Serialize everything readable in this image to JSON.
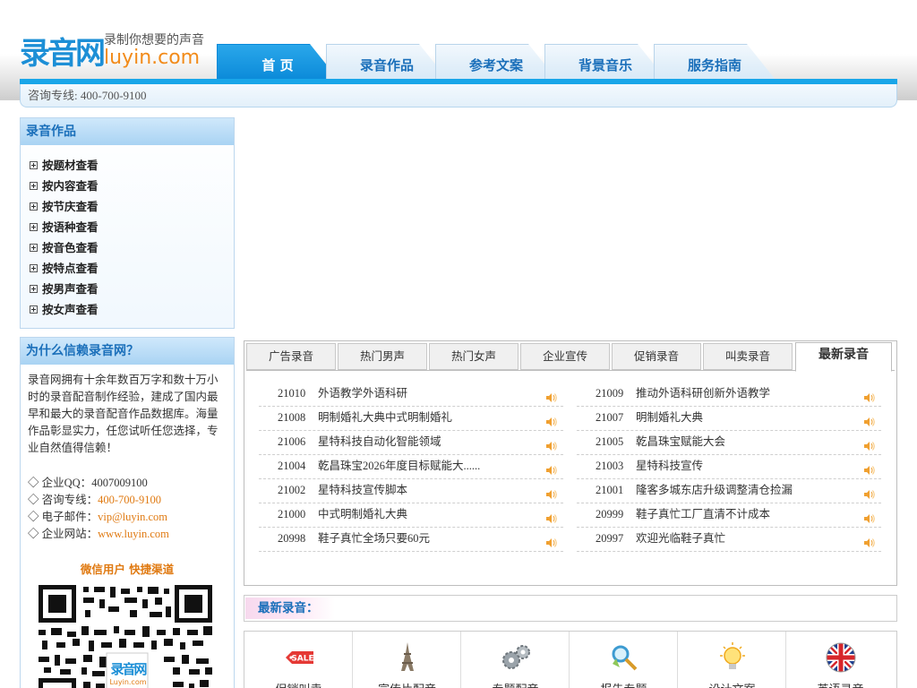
{
  "site": {
    "logo_mark": "录音网",
    "slogan": "录制你想要的声音",
    "domain": "luyin.com"
  },
  "nav": [
    {
      "label": "首 页",
      "active": true
    },
    {
      "label": "录音作品"
    },
    {
      "label": "参考文案"
    },
    {
      "label": "背景音乐"
    },
    {
      "label": "服务指南"
    }
  ],
  "hotline": "咨询专线: 400-700-9100",
  "works_panel": {
    "title": "录音作品",
    "items": [
      "按题材查看",
      "按内容查看",
      "按节庆查看",
      "按语种查看",
      "按音色查看",
      "按特点查看",
      "按男声查看",
      "按女声查看"
    ]
  },
  "why_panel": {
    "title": "为什么信赖录音网？",
    "intro": "录音网拥有十余年数百万字和数十万小时的录音配音制作经验，建成了国内最早和最大的录音配音作品数据库。海量作品彰显实力，任您试听任您选择，专业自然值得信赖！",
    "contacts": [
      {
        "label": "◇ 企业QQ：",
        "value": "4007009100",
        "accent": false
      },
      {
        "label": "◇ 咨询专线：",
        "value": "400-700-9100",
        "accent": true
      },
      {
        "label": "◇ 电子邮件：",
        "value": "vip@luyin.com",
        "accent": true
      },
      {
        "label": "◇ 企业网站：",
        "value": "www.luyin.com",
        "accent": true
      }
    ],
    "wechat": "微信用户 快捷渠道",
    "qr_logo": "录音网",
    "qr_domain": "Luyin.com"
  },
  "tabs": [
    "广告录音",
    "热门男声",
    "热门女声",
    "企业宣传",
    "促销录音",
    "叫卖录音",
    "最新录音"
  ],
  "active_tab": "最新录音",
  "list_left": [
    {
      "num": "21010",
      "title": "外语教学外语科研"
    },
    {
      "num": "21008",
      "title": "明制婚礼大典中式明制婚礼"
    },
    {
      "num": "21006",
      "title": "星特科技自动化智能领域"
    },
    {
      "num": "21004",
      "title": "乾昌珠宝2026年度目标赋能大......"
    },
    {
      "num": "21002",
      "title": "星特科技宣传脚本"
    },
    {
      "num": "21000",
      "title": "中式明制婚礼大典"
    },
    {
      "num": "20998",
      "title": "鞋子真忙全场只要60元"
    }
  ],
  "list_right": [
    {
      "num": "21009",
      "title": "推动外语科研创新外语教学"
    },
    {
      "num": "21007",
      "title": "明制婚礼大典"
    },
    {
      "num": "21005",
      "title": "乾昌珠宝赋能大会"
    },
    {
      "num": "21003",
      "title": "星特科技宣传"
    },
    {
      "num": "21001",
      "title": "隆客多城东店升级调整清仓捡漏"
    },
    {
      "num": "20999",
      "title": "鞋子真忙工厂直清不计成本"
    },
    {
      "num": "20997",
      "title": "欢迎光临鞋子真忙"
    }
  ],
  "new_heading": "最新录音：",
  "categories": [
    {
      "label": "促销叫卖",
      "icon": "sale-tag-icon",
      "icon_text": "SALE"
    },
    {
      "label": "宣传片配音",
      "icon": "eiffel-tower-icon"
    },
    {
      "label": "专题配音",
      "icon": "gears-icon"
    },
    {
      "label": "报告专题",
      "icon": "magnifier-icon"
    },
    {
      "label": "设计文案",
      "icon": "lightbulb-icon"
    },
    {
      "label": "英语录音",
      "icon": "uk-flag-icon"
    }
  ],
  "colors": {
    "brand_blue": "#19a6e9",
    "nav_text": "#1a6fba",
    "accent_orange": "#e07a12"
  }
}
